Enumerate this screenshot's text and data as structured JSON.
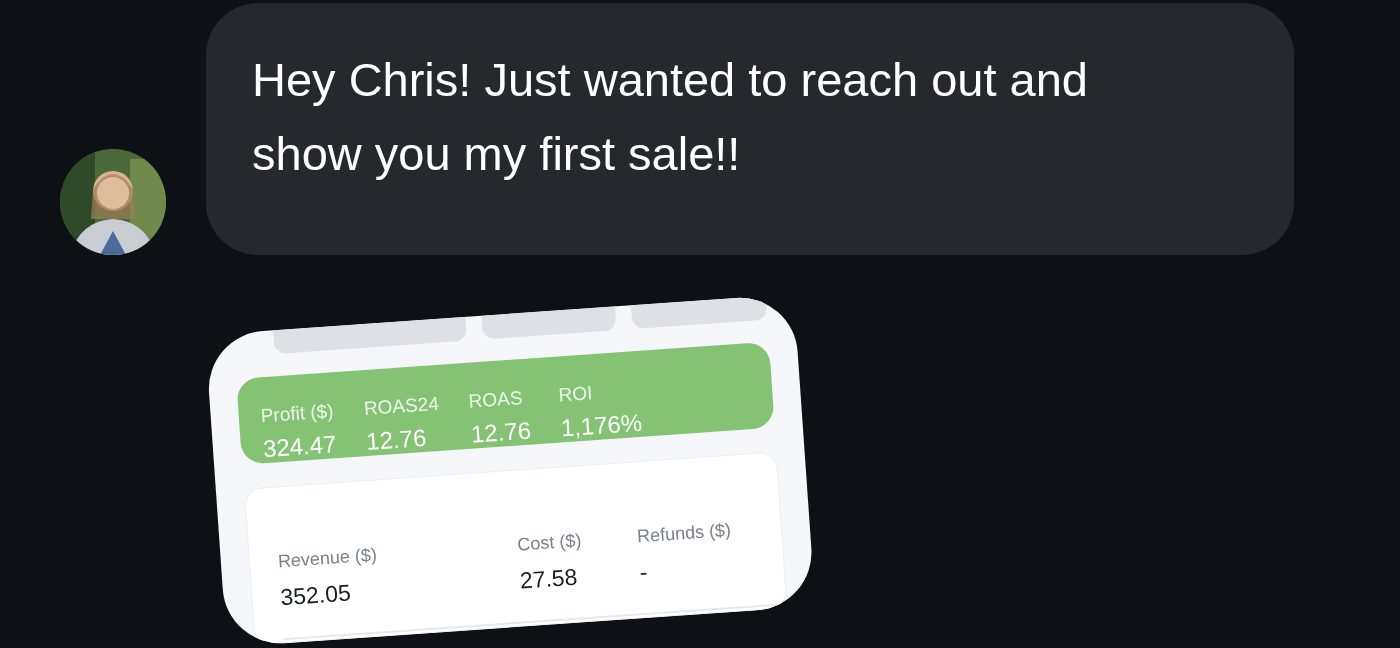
{
  "message": {
    "text": "Hey Chris! Just wanted to reach out and show you my first sale!!"
  },
  "attachment": {
    "kind": "screenshot",
    "filters": [
      {
        "kind": "date"
      },
      {
        "kind": "utms"
      },
      {
        "kind": "bars"
      }
    ],
    "highlights": [
      {
        "label": "Profit ($)",
        "value": "324.47"
      },
      {
        "label": "ROAS24",
        "value": "12.76"
      },
      {
        "label": "ROAS",
        "value": "12.76"
      },
      {
        "label": "ROI",
        "value": "1,176%"
      }
    ],
    "stats": [
      {
        "label": "Revenue ($)",
        "value": "352.05"
      },
      {
        "label": "Cost ($)",
        "value": "27.58"
      },
      {
        "label": "Refunds ($)",
        "value": "-"
      }
    ]
  }
}
